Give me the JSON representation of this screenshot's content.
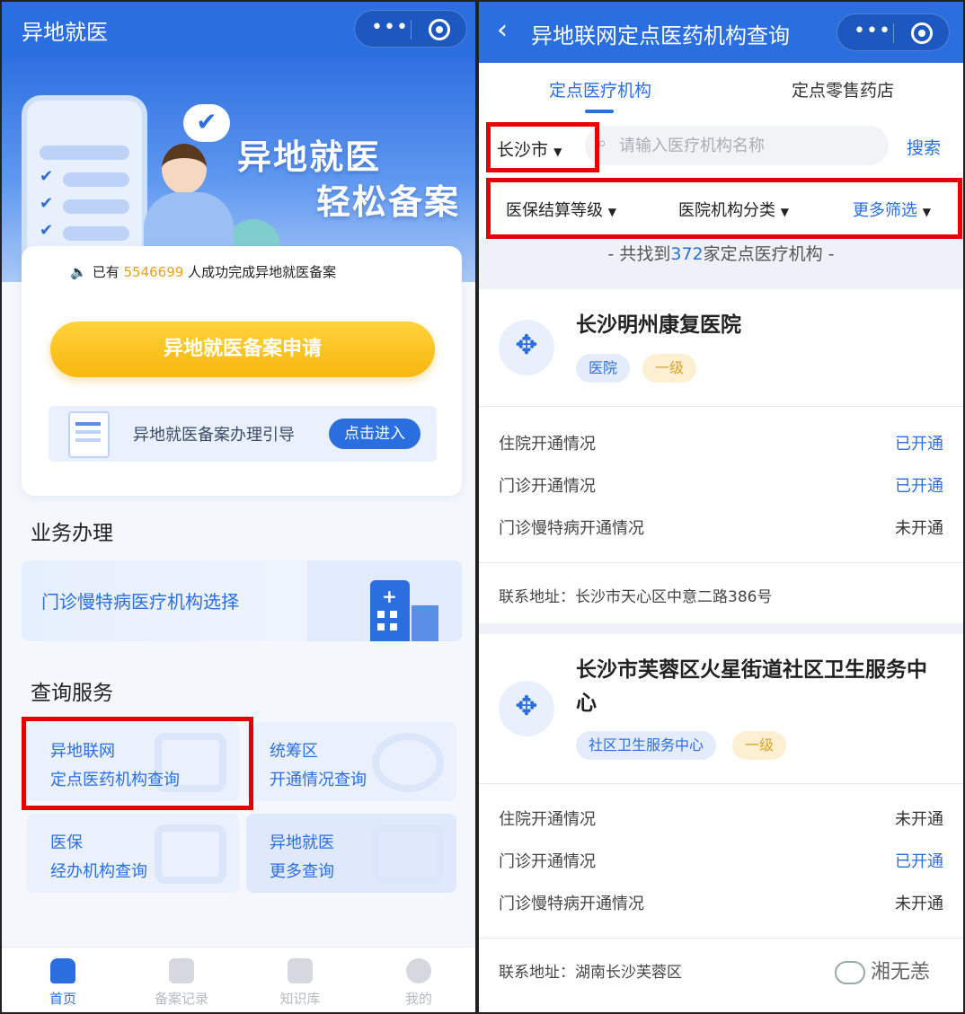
{
  "left": {
    "title": "异地就医",
    "hero": {
      "line1": "异地就医",
      "line2": "轻松备案"
    },
    "notice": {
      "prefix": "已有",
      "count": "5546699",
      "suffix": " 人成功完成异地就医备案"
    },
    "apply_button": "异地就医备案申请",
    "guide": {
      "text": "异地就医备案办理引导",
      "button": "点击进入"
    },
    "business": {
      "title": "业务办理",
      "item": "门诊慢特病医疗机构选择"
    },
    "query": {
      "title": "查询服务",
      "tiles": [
        {
          "line1": "异地联网",
          "line2": "定点医药机构查询"
        },
        {
          "line1": "统筹区",
          "line2": "开通情况查询"
        },
        {
          "line1": "医保",
          "line2": "经办机构查询"
        },
        {
          "line1": "异地就医",
          "line2": "更多查询"
        }
      ]
    },
    "tabbar": [
      {
        "label": "首页",
        "icon": "home-icon"
      },
      {
        "label": "备案记录",
        "icon": "record-icon"
      },
      {
        "label": "知识库",
        "icon": "knowledge-icon"
      },
      {
        "label": "我的",
        "icon": "profile-icon"
      }
    ]
  },
  "right": {
    "title": "异地联网定点医药机构查询",
    "tabs": [
      "定点医疗机构",
      "定点零售药店"
    ],
    "city": "长沙市",
    "search": {
      "placeholder": "请输入医疗机构名称",
      "button": "搜索"
    },
    "filters": [
      "医保结算等级",
      "医院机构分类",
      "更多筛选"
    ],
    "count": {
      "prefix": "- 共找到",
      "number": "372",
      "suffix": "家定点医疗机构 -"
    },
    "institutions": [
      {
        "name": "长沙明州康复医院",
        "type": "医院",
        "level": "一级",
        "stats": [
          {
            "label": "住院开通情况",
            "value": "已开通",
            "status": "on"
          },
          {
            "label": "门诊开通情况",
            "value": "已开通",
            "status": "on"
          },
          {
            "label": "门诊慢特病开通情况",
            "value": "未开通",
            "status": "off"
          }
        ],
        "address": "联系地址：长沙市天心区中意二路386号"
      },
      {
        "name": "长沙市芙蓉区火星街道社区卫生服务中心",
        "type": "社区卫生服务中心",
        "level": "一级",
        "stats": [
          {
            "label": "住院开通情况",
            "value": "未开通",
            "status": "off"
          },
          {
            "label": "门诊开通情况",
            "value": "已开通",
            "status": "on"
          },
          {
            "label": "门诊慢特病开通情况",
            "value": "未开通",
            "status": "off"
          }
        ],
        "address": "联系地址：湖南长沙芙蓉区"
      }
    ],
    "watermark": "湘无恙"
  },
  "colors": {
    "primary": "#2a6ee0",
    "accent": "#f7b70e",
    "highlight_box": "#e60000"
  }
}
